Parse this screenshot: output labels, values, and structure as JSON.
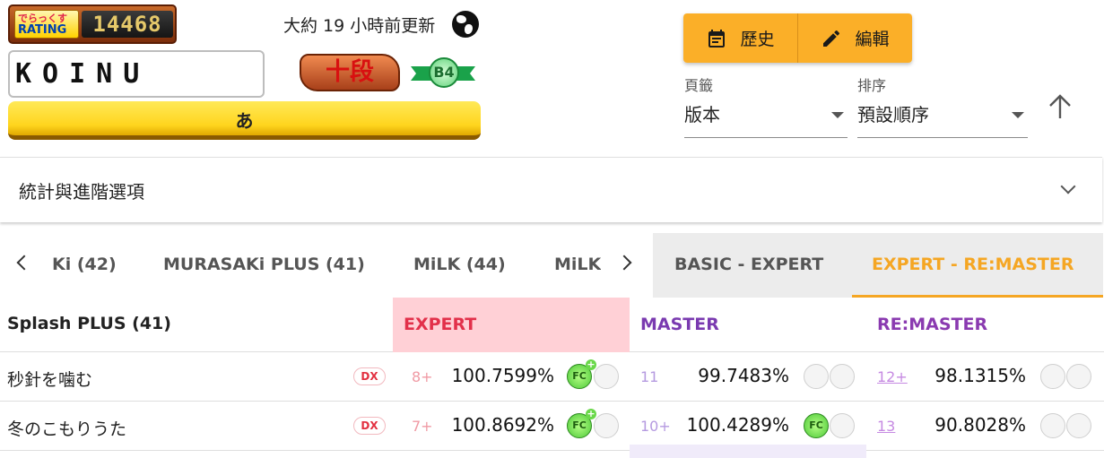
{
  "rating": {
    "label_line1": "でらっくす",
    "label_line2": "RATING",
    "value": "14468"
  },
  "player": {
    "name": "KOINU",
    "dan": "十段",
    "class_rank": "B4",
    "name_bar": "あ"
  },
  "update": {
    "text": "大約 19 小時前更新"
  },
  "actions": {
    "history_label": "歷史",
    "edit_label": "編輯"
  },
  "page_select": {
    "label": "頁籤",
    "value": "版本"
  },
  "sort_select": {
    "label": "排序",
    "value": "預設順序"
  },
  "panel": {
    "title": "統計與進階選項"
  },
  "version_tabs": [
    "Ki (42)",
    "MURASAKi PLUS (41)",
    "MiLK (44)",
    "MiLK"
  ],
  "difficulty_tabs": {
    "basic_expert": "BASIC - EXPERT",
    "expert_remaster": "EXPERT - RE:MASTER",
    "active": "EXPERT - RE:MASTER"
  },
  "table": {
    "group_title": "Splash PLUS (41)",
    "columns": {
      "expert": "EXPERT",
      "master": "MASTER",
      "remaster": "RE:MASTER"
    },
    "colors": {
      "expert_header_bg": "#ffd0d6",
      "expert_text": "#e2304a",
      "master_text": "#7a3ab0",
      "remaster_text": "#8a3ab0",
      "accent": "#f5a623",
      "button": "#fbaf28"
    },
    "rows": [
      {
        "title": "秒針を噛む",
        "type_badge": "DX",
        "expert": {
          "level": "8+",
          "score": "100.7599%",
          "icons": [
            "fc-plus-icon",
            "empty-circle"
          ]
        },
        "master": {
          "level": "11",
          "score": "99.7483%",
          "icons": [
            "empty-circle",
            "empty-circle"
          ]
        },
        "remaster": {
          "level": "12+",
          "score": "98.1315%",
          "icons": [
            "empty-circle",
            "empty-circle"
          ]
        }
      },
      {
        "title": "冬のこもりうた",
        "type_badge": "DX",
        "expert": {
          "level": "7+",
          "score": "100.8692%",
          "icons": [
            "fc-plus-icon",
            "empty-circle"
          ]
        },
        "master": {
          "level": "10+",
          "score": "100.4289%",
          "icons": [
            "fc-icon",
            "empty-circle"
          ]
        },
        "remaster": {
          "level": "13",
          "score": "90.8028%",
          "icons": [
            "empty-circle",
            "empty-circle"
          ]
        }
      }
    ]
  }
}
